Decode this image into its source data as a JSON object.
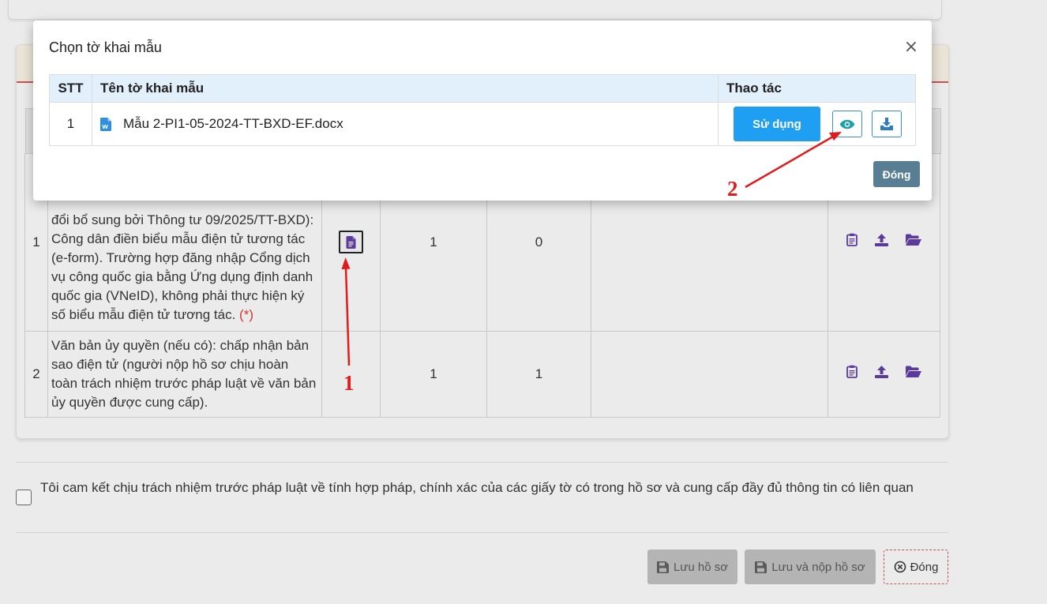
{
  "modal": {
    "title": "Chọn tờ khai mẫu",
    "close_symbol": "×",
    "table": {
      "headers": [
        "STT",
        "Tên tờ khai mẫu",
        "Thao tác"
      ],
      "rows": [
        {
          "stt": "1",
          "file_icon": "word-doc-icon",
          "name": "Mẫu 2-PI1-05-2024-TT-BXD-EF.docx"
        }
      ]
    },
    "use_label": "Sử dụng",
    "view_icon": "eye-icon",
    "download_icon": "download-icon",
    "close_label": "Đóng"
  },
  "background": {
    "rows": [
      {
        "stt": "1",
        "name": "đổi bổ sung bởi Thông tư 09/2025/TT-BXD): Công dân điền biểu mẫu điện tử tương tác (e-form). Trường hợp đăng nhập Cổng dịch vụ công quốc gia bằng Ứng dụng định danh quốc gia (VNeID), không phải thực hiện ký số biểu mẫu điện tử tương tác.",
        "required_mark": "(*)",
        "count_a": "1",
        "count_b": "0"
      },
      {
        "stt": "2",
        "name": "Văn bản ủy quyền (nếu có): chấp nhận bản sao điện tử (người nộp hồ sơ chịu hoàn toàn trách nhiệm trước pháp luật về văn bản ủy quyền được cung cấp).",
        "count_a": "1",
        "count_b": "1"
      }
    ],
    "commitment": "Tôi cam kết chịu trách nhiệm trước pháp luật về tính hợp pháp, chính xác của các giấy tờ có trong hồ sơ và cung cấp đầy đủ thông tin có liên quan",
    "save_label": "Lưu hồ sơ",
    "save_submit_label": "Lưu và nộp hồ sơ",
    "close_label": "Đóng"
  },
  "annotations": {
    "label_1": "1",
    "label_2": "2"
  },
  "colors": {
    "accent_blue": "#1e9ff2",
    "close_button": "#587e94",
    "icon_purple": "#5b3a9e",
    "annotation_red": "#e11b1b",
    "table_header": "#e1f0fb"
  }
}
